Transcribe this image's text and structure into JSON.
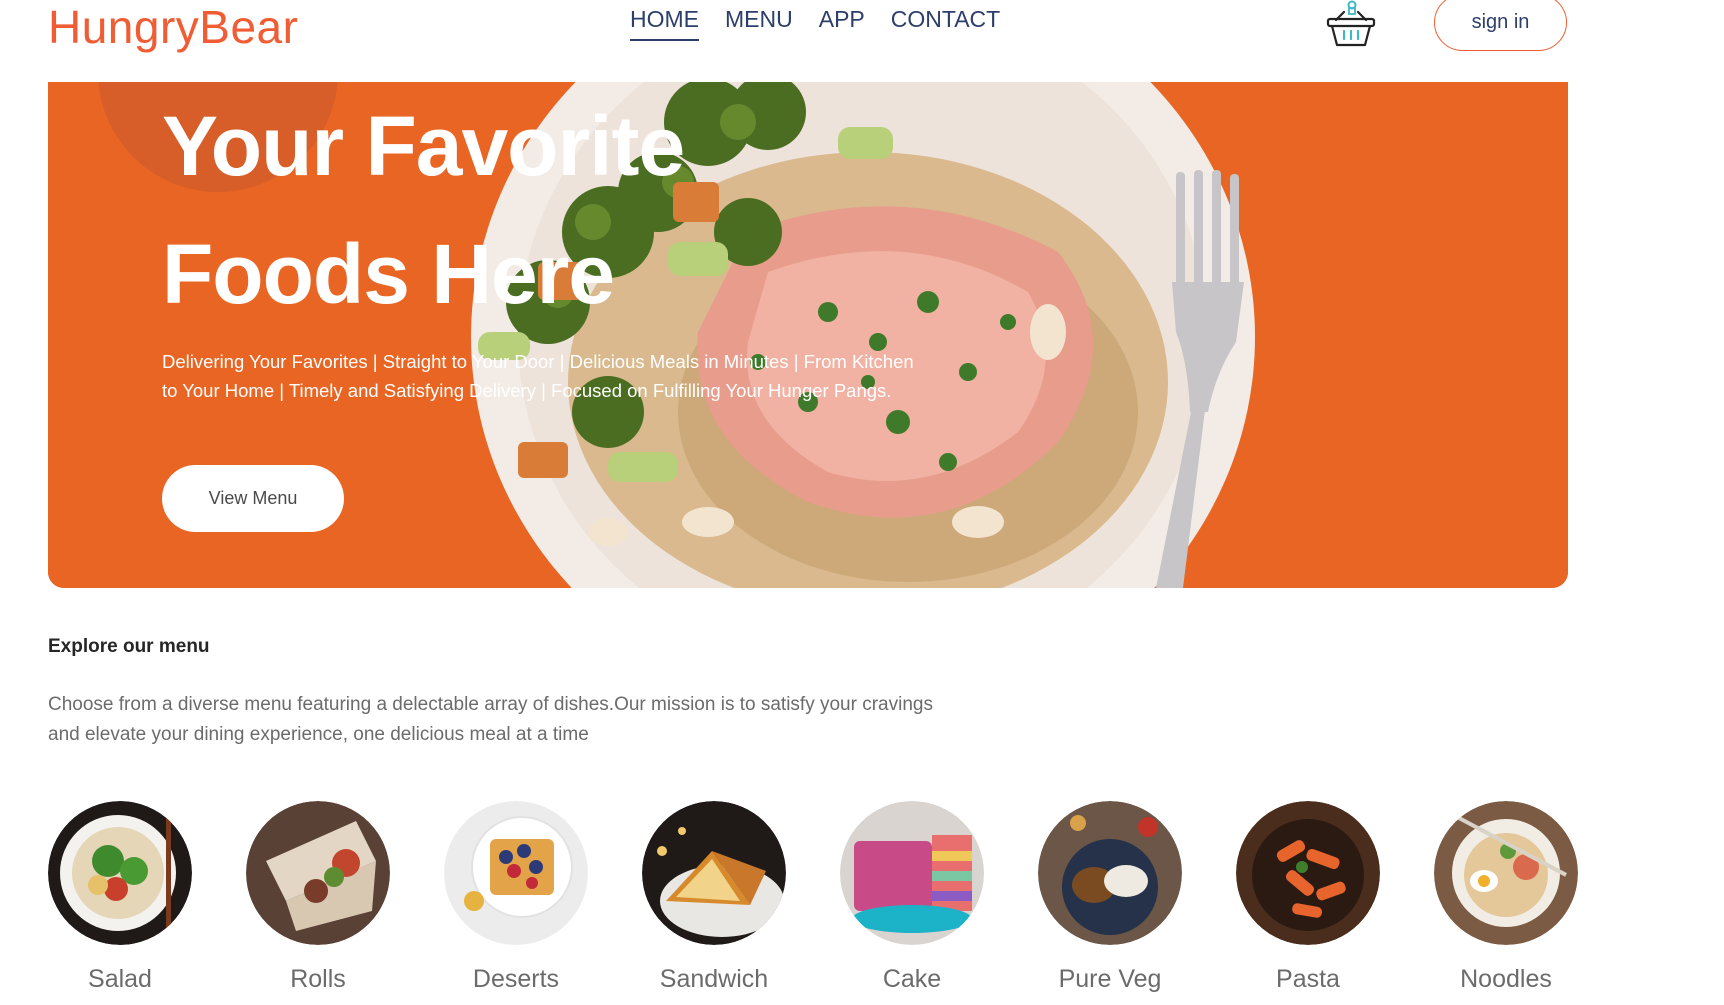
{
  "brand": {
    "logo": "HungryBear",
    "accent": "#f05d34",
    "nav_color": "#2d3e6b"
  },
  "nav": {
    "links": [
      "HOME",
      "MENU",
      "APP",
      "CONTACT"
    ],
    "active": "HOME",
    "signin_label": "sign in",
    "basket_icon": "basket-icon"
  },
  "hero": {
    "title_line1": "Your Favorite",
    "title_line2": "Foods Here",
    "description": "Delivering Your Favorites | Straight to Your Door | Delicious Meals in Minutes | From Kitchen to Your Home | Timely and Satisfying Delivery | Focused on Fulfilling Your Hunger Pangs.",
    "button_label": "View Menu",
    "background_color": "#e96524"
  },
  "explore": {
    "title": "Explore our menu",
    "description": "Choose from a diverse menu featuring a delectable array of dishes.Our mission is to satisfy your cravings and elevate your dining experience, one delicious meal at a time"
  },
  "menu": {
    "items": [
      {
        "label": "Salad",
        "icon": "salad-image"
      },
      {
        "label": "Rolls",
        "icon": "rolls-image"
      },
      {
        "label": "Deserts",
        "icon": "deserts-image"
      },
      {
        "label": "Sandwich",
        "icon": "sandwich-image"
      },
      {
        "label": "Cake",
        "icon": "cake-image"
      },
      {
        "label": "Pure Veg",
        "icon": "pure-veg-image"
      },
      {
        "label": "Pasta",
        "icon": "pasta-image"
      },
      {
        "label": "Noodles",
        "icon": "noodles-image"
      }
    ]
  }
}
